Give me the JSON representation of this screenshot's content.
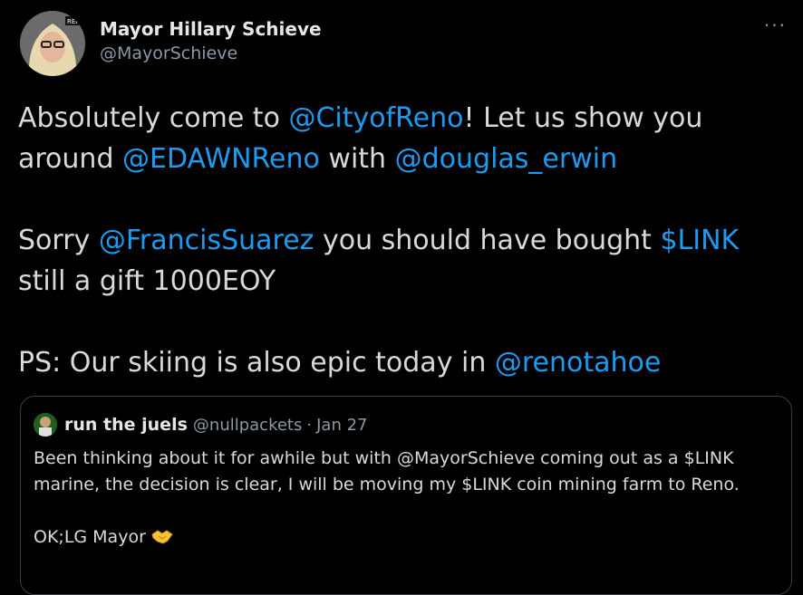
{
  "tweet": {
    "author": {
      "display_name": "Mayor Hillary Schieve",
      "handle": "@MayorSchieve",
      "avatar_icon": "avatar-photo"
    },
    "more_label": "···",
    "text_parts": {
      "p1": "Absolutely come to ",
      "m1": "@CityofReno",
      "p2": "! Let us show you\naround ",
      "m2": "@EDAWNReno",
      "p3": " with ",
      "m3": "@douglas_erwin",
      "p4": "\n\nSorry ",
      "m4": "@FrancisSuarez",
      "p5": " you should have bought ",
      "m5": "$LINK",
      "p6": "\nstill a gift 1000EOY\n\nPS: Our skiing is also epic today in ",
      "m6": "@renotahoe"
    }
  },
  "quoted_tweet": {
    "display_name": "run the juels",
    "handle": "@nullpackets",
    "separator": "·",
    "date": "Jan 27",
    "text": "Been thinking about it for awhile but with @MayorSchieve coming out as a $LINK\nmarine, the decision is clear, I will be moving my $LINK coin mining farm to Reno.\n\nOK;LG Mayor ",
    "emoji": "handshake-icon"
  },
  "colors": {
    "background": "#000000",
    "text": "#d9d9d9",
    "link": "#1d9bf0",
    "secondary": "#8b98a5",
    "border": "#3a3f44"
  }
}
